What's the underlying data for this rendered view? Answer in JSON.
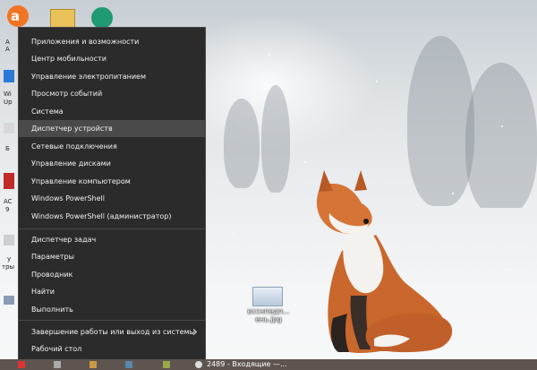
{
  "context_menu": {
    "items": [
      {
        "label": "Приложения и возможности"
      },
      {
        "label": "Центр мобильности"
      },
      {
        "label": "Управление электропитанием"
      },
      {
        "label": "Просмотр событий"
      },
      {
        "label": "Система"
      },
      {
        "label": "Диспетчер устройств",
        "highlighted": true
      },
      {
        "label": "Сетевые подключения"
      },
      {
        "label": "Управление дисками"
      },
      {
        "label": "Управление компьютером"
      },
      {
        "label": "Windows PowerShell"
      },
      {
        "label": "Windows PowerShell (администратор)"
      },
      {
        "label": "Диспетчер задач"
      },
      {
        "label": "Параметры"
      },
      {
        "label": "Проводник"
      },
      {
        "label": "Найти"
      },
      {
        "label": "Выполнить"
      },
      {
        "label": "Завершение работы или выход из системы",
        "has_submenu": true
      },
      {
        "label": "Рабочий стол"
      }
    ]
  },
  "desktop": {
    "left_icon_labels": [
      "А",
      "А",
      "Wi",
      "Up",
      "Б",
      "AC",
      "9",
      "у",
      "тры"
    ],
    "file": {
      "label_line1": "всснпедп...",
      "label_line2": "ень.jpg"
    }
  },
  "taskbar": {
    "active_window_text": "2489 - Входящие —..."
  },
  "colors": {
    "menu_bg": "#2b2b2b",
    "menu_highlight": "#4a4a4a",
    "menu_text": "#f2f2f2",
    "taskbar_bg": "#5e5450",
    "fox_orange": "#c8642a"
  },
  "icons": [
    "avast-icon",
    "folder-icon",
    "download-icon",
    "image-file-icon",
    "submenu-arrow-icon"
  ]
}
